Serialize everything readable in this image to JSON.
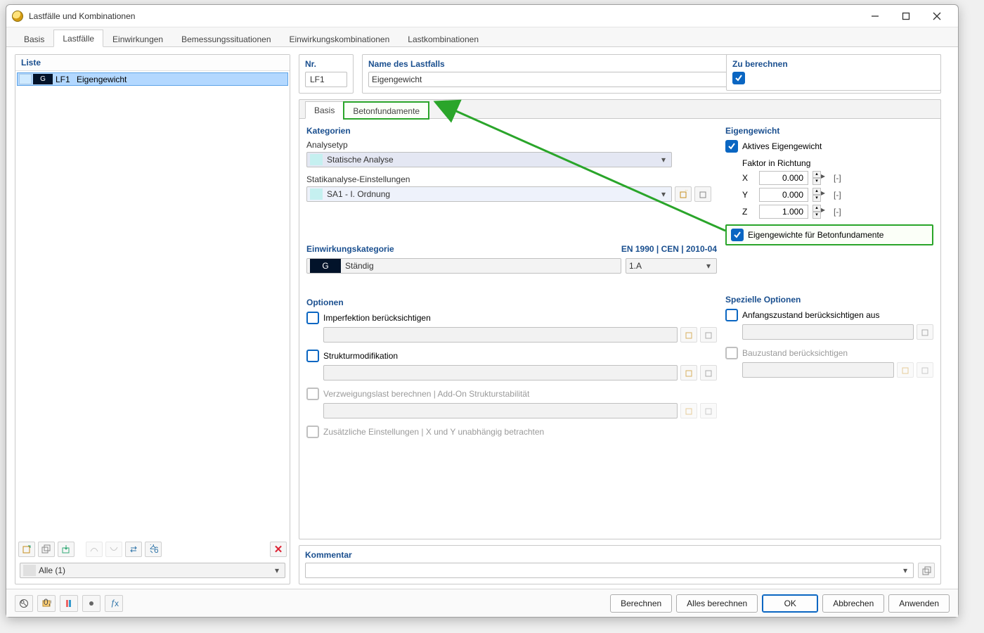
{
  "window": {
    "title": "Lastfälle und Kombinationen"
  },
  "tabs": {
    "basis": "Basis",
    "lastfaelle": "Lastfälle",
    "einwirkungen": "Einwirkungen",
    "bemessung": "Bemessungssituationen",
    "ek": "Einwirkungskombinationen",
    "lk": "Lastkombinationen"
  },
  "left": {
    "header": "Liste",
    "item": {
      "cat": "G",
      "code": "LF1",
      "name": "Eigengewicht"
    },
    "filter": "Alle (1)"
  },
  "top": {
    "nr_label": "Nr.",
    "nr_value": "LF1",
    "name_label": "Name des Lastfalls",
    "name_value": "Eigengewicht",
    "calc_label": "Zu berechnen"
  },
  "subtabs": {
    "basis": "Basis",
    "beton": "Betonfundamente"
  },
  "kategorien": {
    "header": "Kategorien",
    "analysetyp_label": "Analysetyp",
    "analysetyp_value": "Statische Analyse",
    "statik_label": "Statikanalyse-Einstellungen",
    "statik_value": "SA1 - I. Ordnung"
  },
  "ek": {
    "header": "Einwirkungskategorie",
    "std": "EN 1990 | CEN | 2010-04",
    "cat": "G",
    "value": "Ständig",
    "sub": "1.A"
  },
  "optionen": {
    "header": "Optionen",
    "imperfektion": "Imperfektion berücksichtigen",
    "strukturmod": "Strukturmodifikation",
    "verzweigung": "Verzweigungslast berechnen | Add-On Strukturstabilität",
    "zusatz": "Zusätzliche Einstellungen | X und Y unabhängig betrachten"
  },
  "eigengewicht": {
    "header": "Eigengewicht",
    "aktiv": "Aktives Eigengewicht",
    "faktor": "Faktor in Richtung",
    "x": {
      "label": "X",
      "value": "0.000",
      "unit": "[-]"
    },
    "y": {
      "label": "Y",
      "value": "0.000",
      "unit": "[-]"
    },
    "z": {
      "label": "Z",
      "value": "1.000",
      "unit": "[-]"
    },
    "beton": "Eigengewichte für Betonfundamente"
  },
  "spezielle": {
    "header": "Spezielle Optionen",
    "anfang": "Anfangszustand berücksichtigen aus",
    "bau": "Bauzustand berücksichtigen"
  },
  "kommentar": {
    "header": "Kommentar"
  },
  "footer": {
    "berechnen": "Berechnen",
    "alles": "Alles berechnen",
    "ok": "OK",
    "abbrechen": "Abbrechen",
    "anwenden": "Anwenden"
  }
}
